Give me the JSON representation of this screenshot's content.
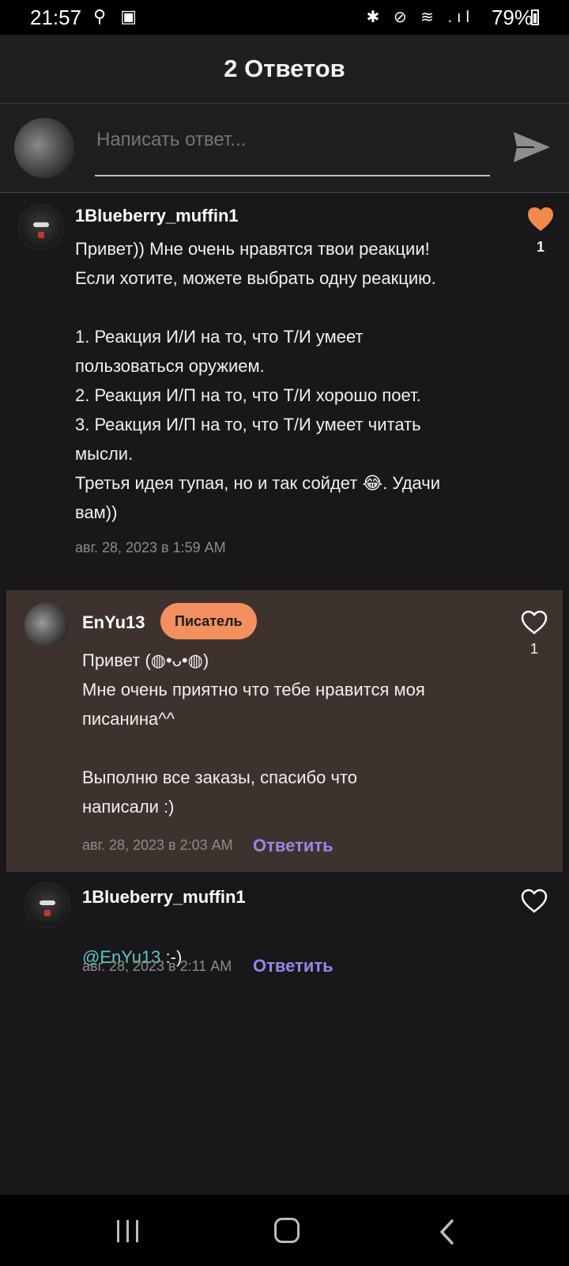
{
  "status_bar": {
    "time": "21:57",
    "left_icons": "⚲ ▣",
    "right_icons": "✱ ⊘ ≋ .ıl",
    "battery": "79%"
  },
  "header": {
    "title": "2 Ответов"
  },
  "composer": {
    "placeholder": "Написать ответ..."
  },
  "comments": [
    {
      "username": "1Blueberry_muffin1",
      "text": "Привет)) Мне очень нравятся твои реакции!\nЕсли хотите, можете выбрать одну реакцию.\n\n1. Реакция И/И на то, что Т/И умеет\nпользоваться оружием.\n2. Реакция И/П на то, что Т/И хорошо поет.\n3. Реакция И/П на то, что Т/И умеет читать\nмысли.\nТретья идея тупая, но и так сойдет 😂. Удачи\nвам))",
      "timestamp": "авг. 28, 2023 в 1:59 AM",
      "likes": "1",
      "liked": true
    },
    {
      "username": "EnYu13",
      "badge": "Писатель",
      "text": "Привет (◍•ᴗ•◍)\nМне очень приятно что тебе нравится моя\nписанина^^\n\nВыполню все заказы, спасибо что\nнаписали :)",
      "timestamp": "авг. 28, 2023 в 2:03 AM",
      "reply_label": "Ответить",
      "likes": "1",
      "liked": false
    },
    {
      "username": "1Blueberry_muffin1",
      "mention": "@EnYu13",
      "text": " :-)",
      "timestamp": "авг. 28, 2023 в 2:11 AM",
      "reply_label": "Ответить",
      "liked": false
    }
  ],
  "colors": {
    "background": "#18171a",
    "header": "#1f1f22",
    "highlight": "#3e322f",
    "like_active": "#f28a4a",
    "badge": "#f29060",
    "reply_link": "#9a86e6",
    "mention": "#5ec4c0"
  }
}
